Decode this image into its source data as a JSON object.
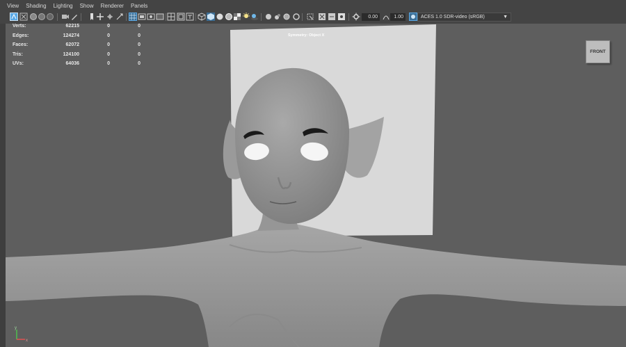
{
  "menu": [
    "View",
    "Shading",
    "Lighting",
    "Show",
    "Renderer",
    "Panels"
  ],
  "toolbar": {
    "exposure_value": "0.00",
    "gamma_value": "1.00",
    "color_space": "ACES 1.0 SDR-video (sRGB)"
  },
  "stats": [
    {
      "label": "Verts:",
      "v1": "62215",
      "v2": "0",
      "v3": "0"
    },
    {
      "label": "Edges:",
      "v1": "124274",
      "v2": "0",
      "v3": "0"
    },
    {
      "label": "Faces:",
      "v1": "62072",
      "v2": "0",
      "v3": "0"
    },
    {
      "label": "Tris:",
      "v1": "124100",
      "v2": "0",
      "v3": "0"
    },
    {
      "label": "UVs:",
      "v1": "64036",
      "v2": "0",
      "v3": "0"
    }
  ],
  "view_cube_label": "FRONT",
  "symmetry_label": "Symmetry: Object X",
  "axis_labels": {
    "y": "y",
    "x": "x"
  },
  "colors": {
    "viewport_bg": "#5e5e5e",
    "menubar_bg": "#444444",
    "image_plane": "#d8d8d8",
    "mesh": "#a8a8a8",
    "accent": "#5aa9e6"
  }
}
